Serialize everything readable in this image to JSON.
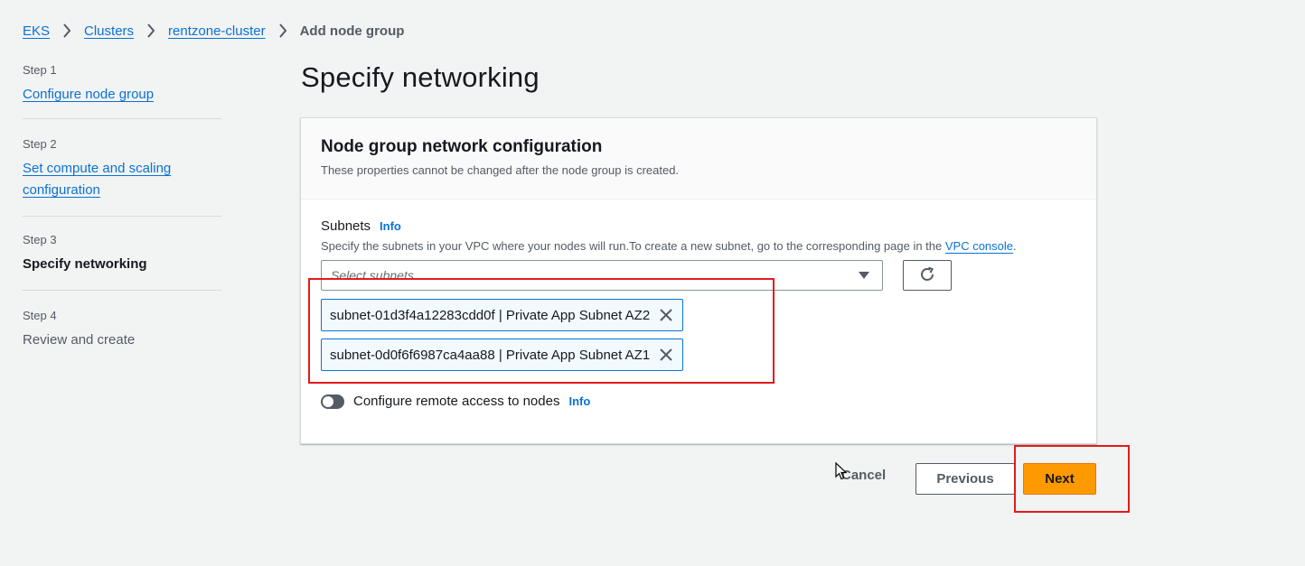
{
  "breadcrumb": {
    "items": [
      "EKS",
      "Clusters",
      "rentzone-cluster"
    ],
    "current": "Add node group"
  },
  "steps": [
    {
      "num": "Step 1",
      "title": "Configure node group"
    },
    {
      "num": "Step 2",
      "title": "Set compute and scaling configuration"
    },
    {
      "num": "Step 3",
      "title": "Specify networking"
    },
    {
      "num": "Step 4",
      "title": "Review and create"
    }
  ],
  "page": {
    "title": "Specify networking"
  },
  "panel": {
    "title": "Node group network configuration",
    "description": "These properties cannot be changed after the node group is created."
  },
  "subnets": {
    "label": "Subnets",
    "info": "Info",
    "description_prefix": "Specify the subnets in your VPC where your nodes will run.To create a new subnet, go to the corresponding page in the ",
    "description_link": "VPC console",
    "description_suffix": ".",
    "placeholder": "Select subnets",
    "selected": [
      "subnet-01d3f4a12283cdd0f | Private App Subnet AZ2",
      "subnet-0d0f6f6987ca4aa88 | Private App Subnet AZ1"
    ]
  },
  "remote_access": {
    "label": "Configure remote access to nodes",
    "info": "Info",
    "enabled": false
  },
  "actions": {
    "cancel": "Cancel",
    "previous": "Previous",
    "next": "Next"
  },
  "colors": {
    "accent": "#0972d3",
    "primary_button": "#ff9900",
    "annotation": "#e31b1b"
  }
}
